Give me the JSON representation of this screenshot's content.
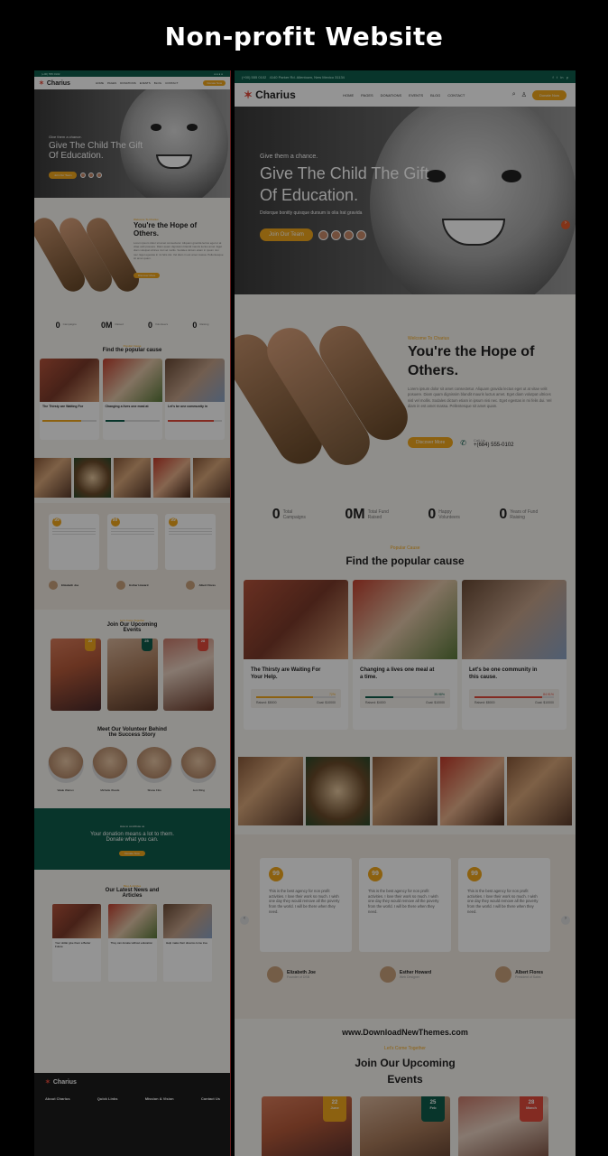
{
  "page_title": "Non-profit Website",
  "colors": {
    "accent": "#f2a81d",
    "brand_green": "#0f5c4a",
    "brand_red": "#e24a3b"
  },
  "topbar": {
    "phone": "(+00) 555 0102",
    "address": "4140 Parker Rd. Allentown, New Mexico 31134"
  },
  "nav": {
    "logo": "Charius",
    "menu": [
      "HOME",
      "PAGES",
      "DONATIONS",
      "EVENTS",
      "BLOG",
      "CONTACT"
    ],
    "donate_label": "Donate Now"
  },
  "hero": {
    "kicker": "Give them a chance.",
    "headline_1": "Give The Child The Gift",
    "headline_2": "Of Education.",
    "subtitle": "Dolorque bonitly quisque dursum is olia lrat gravida",
    "cta": "Join Our Team"
  },
  "about": {
    "tag": "Welcome To Charius",
    "title_1": "You're the Hope of",
    "title_2": "Others.",
    "body": "Lorem ipsum dolor sit amet consectetur. Aliquam gravida lectus eget ut at vitae velit posuere. Diam quam dignissim blandit mauris luctus amet. Eget diam volutpat ultrices nisl vel mollis. Sodales dictum etiam in ipsum nisi nec. Eget egestas in mi felis dui. Vel diam in est amet massa. Pellentesque sit amet quam.",
    "cta": "Discover More",
    "call_label": "Call Us",
    "phone": "+(684) 555-0102"
  },
  "stats": [
    {
      "value": "0",
      "label_1": "Total",
      "label_2": "Campaigns"
    },
    {
      "value": "0M",
      "label_1": "Total Fund",
      "label_2": "Raised"
    },
    {
      "value": "0",
      "label_1": "Happy",
      "label_2": "Volunteers"
    },
    {
      "value": "0",
      "label_1": "Years of Fund",
      "label_2": "Raising"
    }
  ],
  "causes": {
    "tag": "Popular Cause",
    "title": "Find the popular cause",
    "items": [
      {
        "title_1": "The Thirsty are Waiting For",
        "title_2": "Your Help.",
        "progress": 0.72,
        "pct": "72%",
        "raised": "Raised: $8000",
        "goal": "Goal: $10000",
        "color": "#f2a81d"
      },
      {
        "title_1": "Changing a lives one meal at",
        "title_2": "a time.",
        "progress": 0.35,
        "pct": "35.98%",
        "raised": "Raised: $4000",
        "goal": "Goal: $10000",
        "color": "#0f5c4a"
      },
      {
        "title_1": "Let's be one community in",
        "title_2": "this cause.",
        "progress": 0.85,
        "pct": "84.91%",
        "raised": "Raised: $8000",
        "goal": "Goal: $10000",
        "color": "#e24a3b"
      }
    ]
  },
  "testimonials": [
    {
      "text": "This is the best agency for non profit activities. I love their work so much. I wish one day they would remove all the poverty from the world. I will be there when they need.",
      "name": "Elizabeth Joe",
      "role": "Founder of DSB"
    },
    {
      "text": "This is the best agency for non profit activities. I love their work so much. I wish one day they would remove all the poverty from the world. I will be there when they need.",
      "name": "Esther Howard",
      "role": "Web Designer"
    },
    {
      "text": "This is the best agency for non profit activities. I love their work so much. I wish one day they would remove all the poverty from the world. I will be there when they need.",
      "name": "Albert Flores",
      "role": "President of Sales"
    }
  ],
  "watermark": "www.DownloadNewThemes.com",
  "events": {
    "tag": "Let's Come Together",
    "title_1": "Join Our Upcoming",
    "title_2": "Events",
    "items": [
      {
        "day": "22",
        "month": "June",
        "color": "#f2a81d",
        "title": "Share The Warmth Of Children"
      },
      {
        "day": "25",
        "month": "Feb",
        "color": "#0f5c4a",
        "title": "Solve The Water Problems of Nations"
      },
      {
        "day": "28",
        "month": "March",
        "color": "#e24a3b",
        "title": "Your Gift Comfort Our Free Needs"
      }
    ]
  },
  "volunteers": {
    "title_1": "Meet Our Volunteer Behind",
    "title_2": "the Success Story",
    "people": [
      {
        "name": "Wade Warren",
        "role": "Volunteer"
      },
      {
        "name": "Michelle Woods",
        "role": "Volunteer"
      },
      {
        "name": "Shane Fitts",
        "role": "Volunteer"
      },
      {
        "name": "Jeni Wing",
        "role": "Volunteer"
      }
    ]
  },
  "donation": {
    "tag": "How to contribute us",
    "line_1": "Your donation means a lot to them.",
    "line_2": "Donate what you can.",
    "cta": "Donate Now"
  },
  "news": {
    "tag": "Blog & Articles",
    "title_1": "Our Latest News and",
    "title_2": "Articles",
    "items": [
      {
        "title": "Your dollar give them a Better Future",
        "more": "Read More"
      },
      {
        "title": "They can donate without education",
        "more": "Read More"
      },
      {
        "title": "Help make their dreams come true",
        "more": "Read More"
      }
    ]
  },
  "footer": {
    "logo": "Charius",
    "columns": [
      "About Charius",
      "Quick Links",
      "Mission & Vision",
      "Contact Us"
    ]
  }
}
